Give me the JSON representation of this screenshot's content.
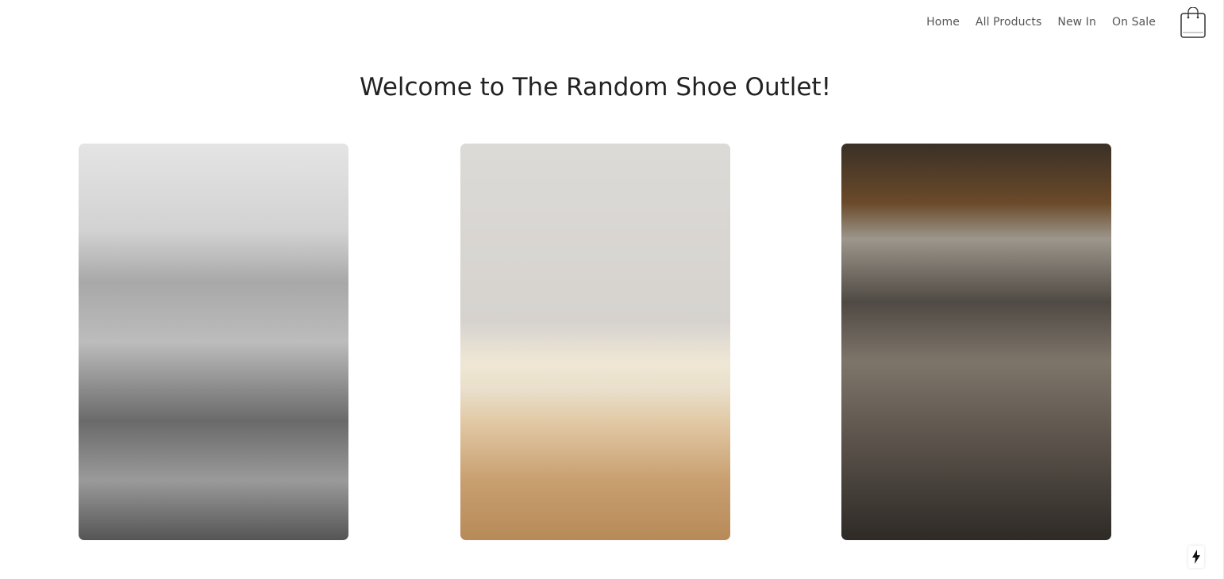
{
  "nav": {
    "items": [
      "Home",
      "All Products",
      "New In",
      "On Sale"
    ]
  },
  "header": {
    "cart_icon": "shopping-bag-icon"
  },
  "main": {
    "title": "Welcome to The Random Shoe Outlet!"
  },
  "dev_indicator": {
    "icon": "lightning-bolt-icon"
  }
}
